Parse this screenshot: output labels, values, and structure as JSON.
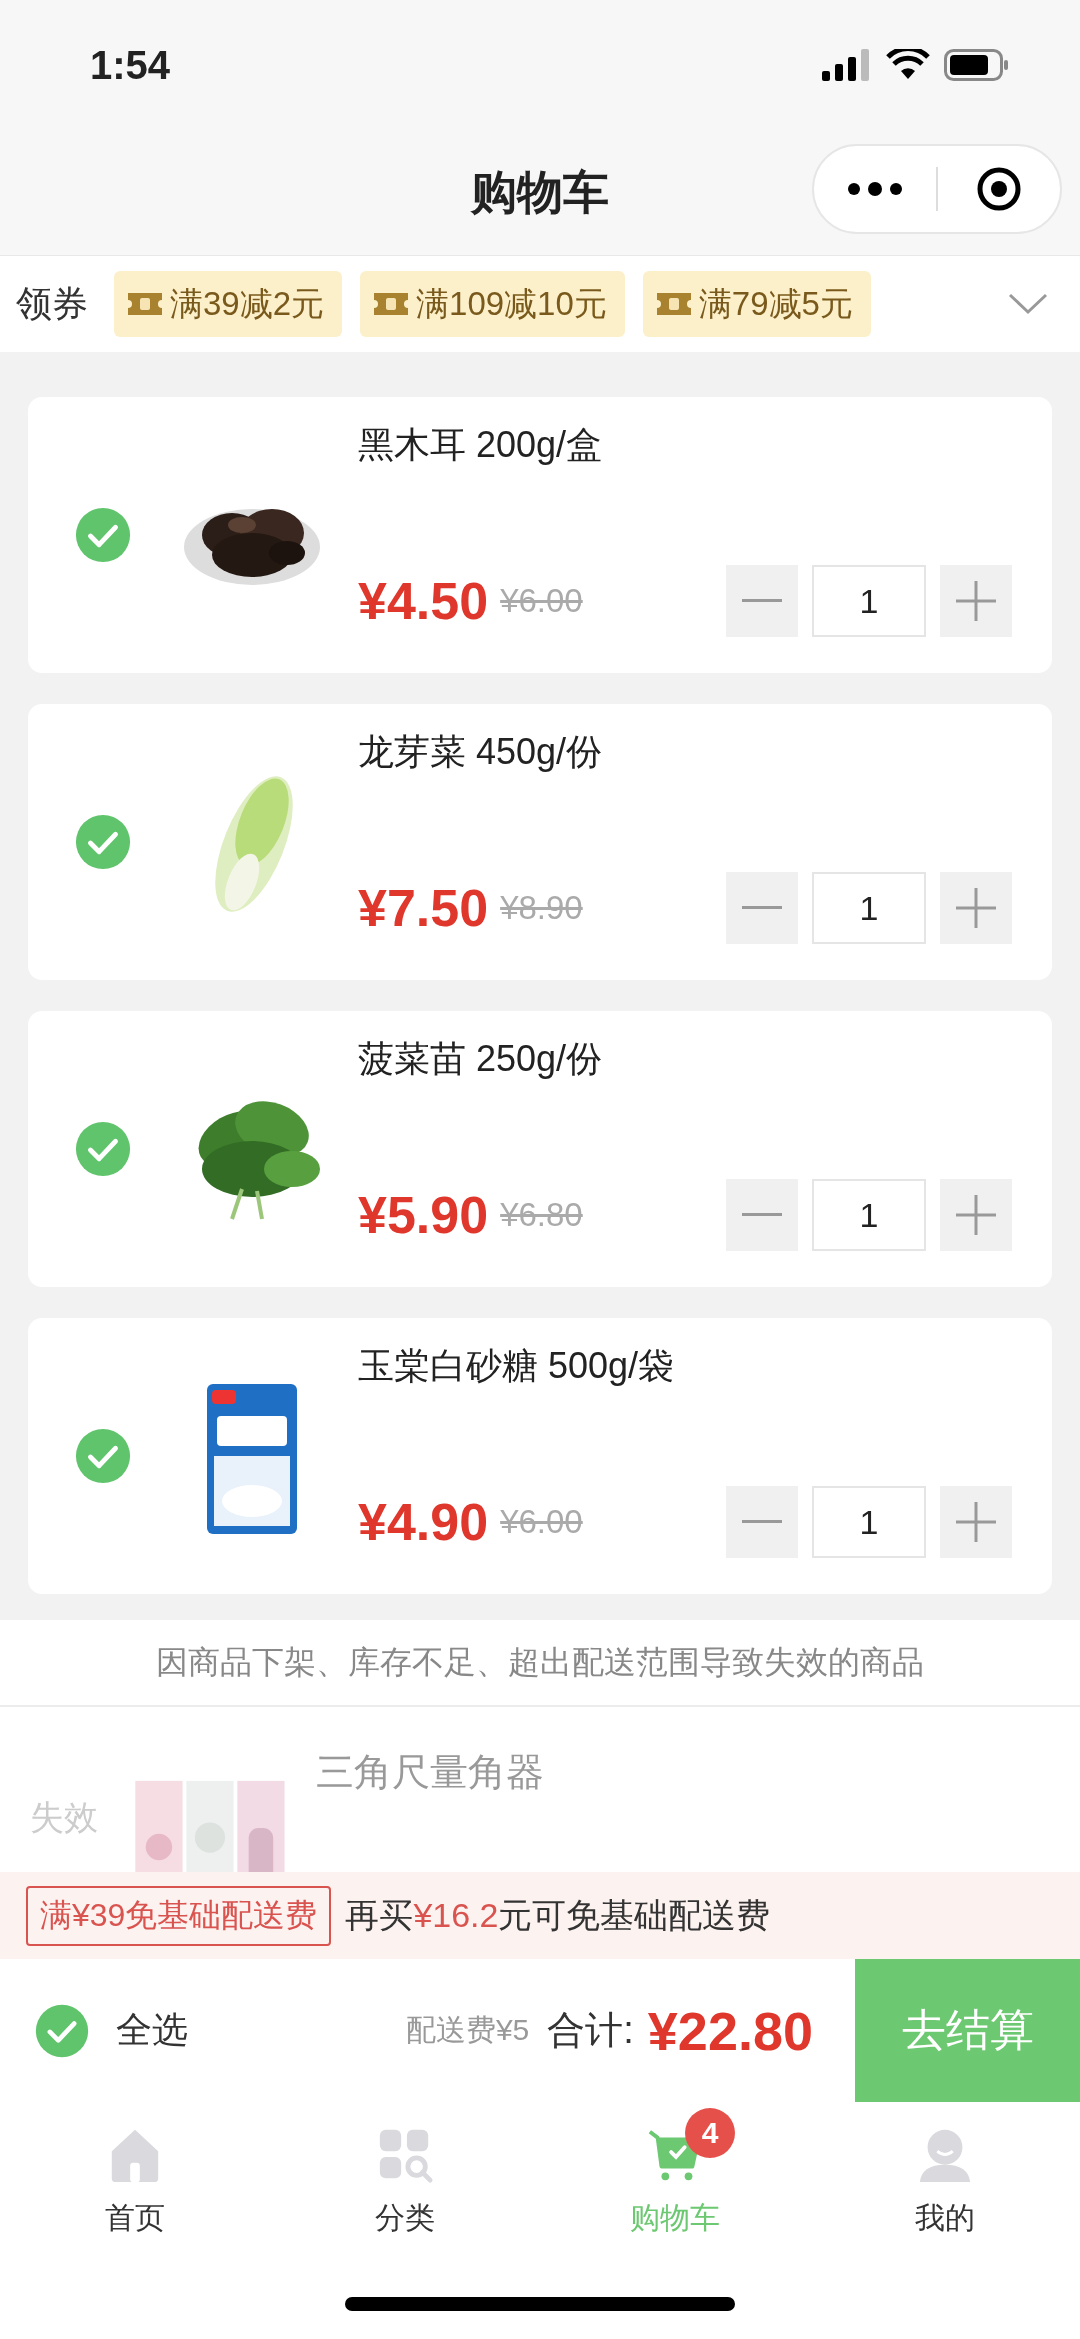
{
  "status_bar": {
    "time": "1:54"
  },
  "header": {
    "title": "购物车"
  },
  "coupons": {
    "label": "领券",
    "items": [
      {
        "text": "满39减2元"
      },
      {
        "text": "满109减10元"
      },
      {
        "text": "满79减5元"
      }
    ]
  },
  "items": [
    {
      "name": "黑木耳 200g/盒",
      "price": "¥4.50",
      "original_price": "¥6.00",
      "quantity": "1",
      "checked": true
    },
    {
      "name": "龙芽菜 450g/份",
      "price": "¥7.50",
      "original_price": "¥8.90",
      "quantity": "1",
      "checked": true
    },
    {
      "name": "菠菜苗 250g/份",
      "price": "¥5.90",
      "original_price": "¥6.80",
      "quantity": "1",
      "checked": true
    },
    {
      "name": "玉棠白砂糖 500g/袋",
      "price": "¥4.90",
      "original_price": "¥6.00",
      "quantity": "1",
      "checked": true
    }
  ],
  "invalid": {
    "notice": "因商品下架、库存不足、超出配送范围导致失效的商品",
    "items": [
      {
        "status": "失效",
        "name": "三角尺量角器"
      }
    ]
  },
  "delivery": {
    "tag": "满¥39免基础配送费",
    "message": "再买**¥16.2**元可免基础配送费"
  },
  "checkout": {
    "select_all": "全选",
    "all_checked": true,
    "delivery_fee": "配送费¥5",
    "total_label": "合计:",
    "total": "¥22.80",
    "button": "去结算"
  },
  "tabs": [
    {
      "label": "首页",
      "selected": false,
      "kind": "home"
    },
    {
      "label": "分类",
      "selected": false,
      "kind": "category"
    },
    {
      "label": "购物车",
      "selected": true,
      "kind": "cart",
      "badge": "4"
    },
    {
      "label": "我的",
      "selected": false,
      "kind": "profile"
    }
  ]
}
